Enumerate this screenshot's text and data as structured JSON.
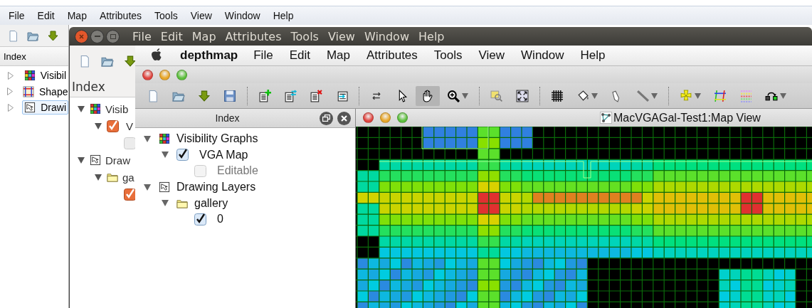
{
  "back_window": {
    "menu": [
      "File",
      "Edit",
      "Map",
      "Attributes",
      "Tools",
      "View",
      "Window",
      "Help"
    ],
    "toolbar": [
      {
        "kind": "new"
      },
      {
        "kind": "open"
      },
      {
        "kind": "import"
      }
    ],
    "index_title": "Index",
    "tree": [
      {
        "kind": "graphs",
        "label": "Visibil",
        "expanded": false,
        "selected": false
      },
      {
        "kind": "shapes",
        "label": "Shape",
        "expanded": false,
        "selected": false
      },
      {
        "kind": "drawing",
        "label": "Drawi",
        "expanded": false,
        "selected": true
      }
    ]
  },
  "ubuntu_window": {
    "menu": [
      "File",
      "Edit",
      "Map",
      "Attributes",
      "Tools",
      "View",
      "Window",
      "Help"
    ],
    "toolbar": [
      {
        "kind": "new"
      },
      {
        "kind": "open"
      },
      {
        "kind": "import"
      }
    ],
    "index_title": "Index",
    "tree": [
      {
        "kind": "graphs",
        "label": "Visib",
        "expanded": true,
        "children": [
          {
            "label": "V",
            "checked": true,
            "expanded": true,
            "children": [
              {
                "checked": false
              }
            ]
          }
        ]
      },
      {
        "kind": "drawing",
        "label": "Draw",
        "expanded": true,
        "children": [
          {
            "kind": "folder",
            "label": "ga",
            "expanded": true,
            "children": [
              {
                "checked": true
              }
            ]
          }
        ]
      }
    ]
  },
  "mac_window": {
    "app_name": "depthmap",
    "menu": [
      "File",
      "Edit",
      "Map",
      "Attributes",
      "Tools",
      "View",
      "Window",
      "Help"
    ],
    "toolbar_groups": [
      {
        "tools": [
          {
            "kind": "new",
            "dropdown": false,
            "selected": false
          },
          {
            "kind": "open",
            "dropdown": false,
            "selected": false
          },
          {
            "kind": "import",
            "dropdown": false,
            "selected": false
          },
          {
            "kind": "save",
            "dropdown": false,
            "selected": false
          }
        ]
      },
      {
        "tools": [
          {
            "kind": "add-layer",
            "dropdown": false,
            "selected": false
          },
          {
            "kind": "edit-layer",
            "dropdown": false,
            "selected": false
          },
          {
            "kind": "delete-layer",
            "dropdown": false,
            "selected": false
          },
          {
            "kind": "colour-import",
            "dropdown": false,
            "selected": false
          }
        ]
      },
      {
        "tools": [
          {
            "kind": "select-link",
            "dropdown": false,
            "selected": false
          },
          {
            "kind": "pointer",
            "dropdown": false,
            "selected": false
          },
          {
            "kind": "hand",
            "dropdown": false,
            "selected": true
          },
          {
            "kind": "zoom",
            "dropdown": true,
            "selected": false
          }
        ]
      },
      {
        "tools": [
          {
            "kind": "zoom-region",
            "dropdown": false,
            "selected": false
          },
          {
            "kind": "fit",
            "dropdown": false,
            "selected": false
          }
        ]
      },
      {
        "tools": [
          {
            "kind": "grid",
            "dropdown": false,
            "selected": false
          },
          {
            "kind": "fill",
            "dropdown": true,
            "selected": false
          },
          {
            "kind": "pencil",
            "dropdown": false,
            "selected": false
          },
          {
            "kind": "line",
            "dropdown": true,
            "selected": false
          }
        ]
      },
      {
        "tools": [
          {
            "kind": "isovist",
            "dropdown": true,
            "selected": false
          },
          {
            "kind": "axial",
            "dropdown": false,
            "selected": false
          },
          {
            "kind": "points",
            "dropdown": false,
            "selected": false
          },
          {
            "kind": "step",
            "dropdown": true,
            "selected": false
          }
        ]
      }
    ],
    "index_title": "Index",
    "tree": [
      {
        "kind": "graphs",
        "label": "Visibility Graphs",
        "expanded": true,
        "children": [
          {
            "label": "VGA Map",
            "checked": true,
            "disabled": false,
            "expanded": true,
            "children": [
              {
                "label": "Editable",
                "checked": false,
                "disabled": true
              }
            ]
          }
        ]
      },
      {
        "kind": "drawing",
        "label": "Drawing Layers",
        "expanded": true,
        "children": [
          {
            "kind": "folder",
            "label": "gallery",
            "expanded": true,
            "children": [
              {
                "label": "0",
                "checked": true,
                "disabled": false
              }
            ]
          }
        ]
      }
    ],
    "map_view": {
      "title": "MacVGAGal-Test1:Map View"
    }
  }
}
